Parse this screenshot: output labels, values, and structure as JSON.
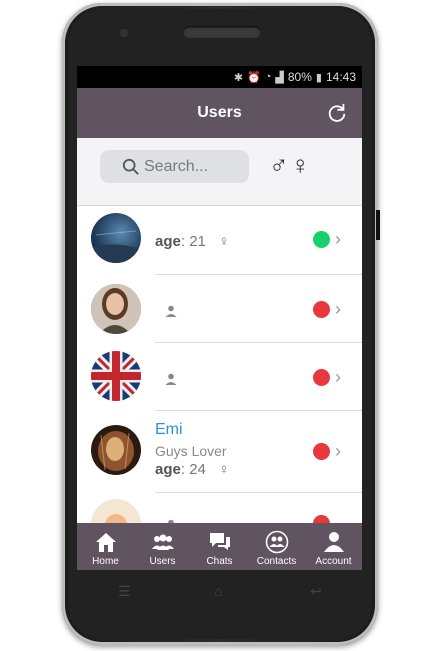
{
  "status_bar": {
    "battery": "80%",
    "time": "14:43"
  },
  "header": {
    "title": "Users"
  },
  "search": {
    "placeholder": "Search...",
    "male_symbol": "♂",
    "female_symbol": "♀"
  },
  "users": [
    {
      "age_label": "age",
      "age": "21",
      "gender_symbol": "♀",
      "status_color": "#16d16a"
    },
    {
      "status_color": "#e8383d"
    },
    {
      "status_color": "#e8383d"
    },
    {
      "name": "Emi",
      "subtitle": "Guys Lover",
      "age_label": "age",
      "age": "24",
      "gender_symbol": "♀",
      "status_color": "#e8383d"
    },
    {
      "status_color": "#e8383d"
    }
  ],
  "tabs": [
    {
      "label": "Home",
      "icon": "home-icon"
    },
    {
      "label": "Users",
      "icon": "users-icon"
    },
    {
      "label": "Chats",
      "icon": "chats-icon"
    },
    {
      "label": "Contacts",
      "icon": "contacts-icon"
    },
    {
      "label": "Account",
      "icon": "account-icon"
    }
  ],
  "colors": {
    "header": "#5f5460",
    "online": "#16d16a",
    "offline": "#e8383d",
    "name": "#2f8fd6"
  }
}
